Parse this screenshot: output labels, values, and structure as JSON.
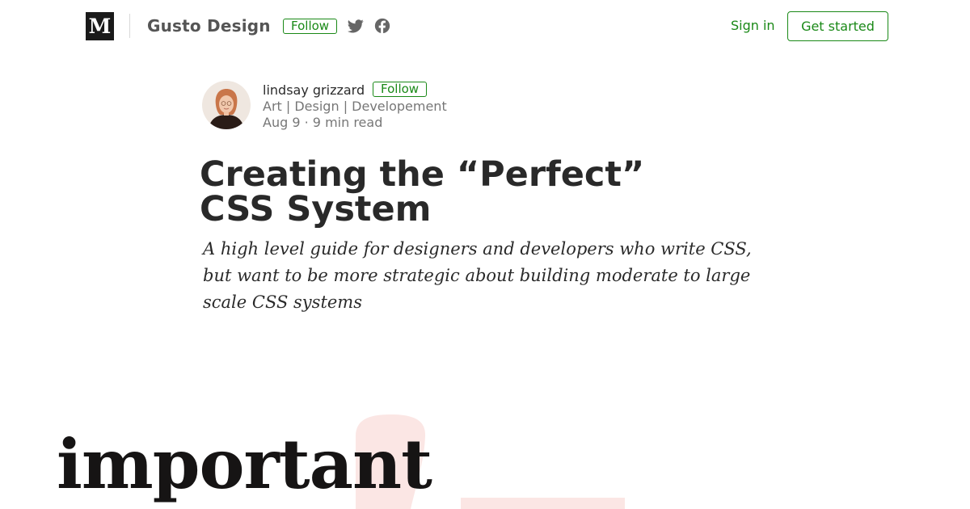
{
  "header": {
    "logo_letter": "M",
    "publication_name": "Gusto Design",
    "follow_label": "Follow",
    "social_icons": [
      "twitter-icon",
      "facebook-icon"
    ],
    "sign_in_label": "Sign in",
    "get_started_label": "Get started"
  },
  "author": {
    "name": "lindsay grizzard",
    "follow_label": "Follow",
    "bio": "Art | Design | Developement",
    "date": "Aug 9",
    "separator": "·",
    "read_time": "9 min read"
  },
  "article": {
    "title_line1": "Creating the “Perfect”",
    "title_line2": "CSS System",
    "subtitle": "A high level guide for designers and developers who write CSS, but want to be more strategic about building moderate to large scale CSS systems"
  },
  "hero": {
    "word": "important"
  },
  "colors": {
    "accent_green": "#1a8917",
    "text_primary": "rgba(0,0,0,0.84)",
    "text_secondary": "rgba(0,0,0,0.54)",
    "hero_shape_pink": "#fbe6e4"
  }
}
